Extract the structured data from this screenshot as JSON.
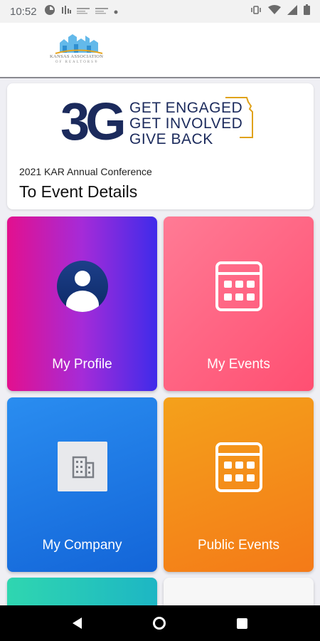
{
  "status_bar": {
    "time": "10:52",
    "left_icons": [
      "app-notification-icon",
      "signal-bars-icon",
      "news-icon",
      "news-icon",
      "dot-icon"
    ],
    "right_icons": [
      "vibrate-icon",
      "wifi-icon",
      "cellular-icon",
      "battery-icon"
    ]
  },
  "header": {
    "logo_name": "Kansas Association of Realtors",
    "logo_text": "KANSAS ASSOCIATION",
    "logo_sub": "OF REALTORS®"
  },
  "event_card": {
    "banner": {
      "mark": "3G",
      "lines": [
        "GET ENGAGED",
        "GET INVOLVED",
        "GIVE BACK"
      ]
    },
    "subtitle": "2021 KAR Annual Conference",
    "title": "To Event Details"
  },
  "tiles": [
    {
      "label": "My Profile",
      "icon": "user-avatar-icon"
    },
    {
      "label": "My Events",
      "icon": "calendar-icon"
    },
    {
      "label": "My Company",
      "icon": "building-icon"
    },
    {
      "label": "Public Events",
      "icon": "calendar-icon"
    },
    {
      "label": "",
      "icon": ""
    },
    {
      "label": "",
      "icon": ""
    }
  ],
  "colors": {
    "profile_gradient": [
      "#e3108e",
      "#3f2bea"
    ],
    "events_gradient": [
      "#ff7b95",
      "#ff4f72"
    ],
    "company_gradient": [
      "#2a8df0",
      "#1365d8"
    ],
    "public_events_gradient": [
      "#f4a11b",
      "#f47a18"
    ],
    "brand_navy": "#1b2a5c",
    "brand_gold": "#e0a21a"
  },
  "nav_bar": {
    "buttons": [
      "back",
      "home",
      "recents"
    ]
  }
}
